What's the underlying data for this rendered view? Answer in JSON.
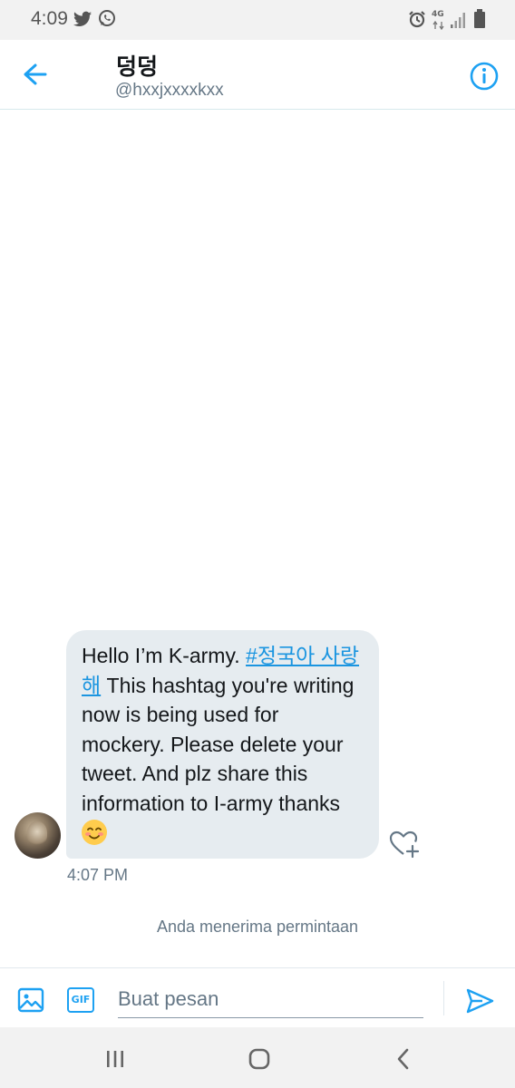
{
  "status_bar": {
    "time": "4:09",
    "network": "4G",
    "icons": [
      "twitter-icon",
      "whatsapp-icon",
      "alarm-icon",
      "signal-icon",
      "battery-icon"
    ]
  },
  "header": {
    "title": "덩덩",
    "handle": "@hxxjxxxxkxx",
    "accent_color": "#1da1f2"
  },
  "message": {
    "text_before": "Hello I’m K-army. ",
    "hashtag": "#정국아 사랑해",
    "text_after": " This hashtag you're writing now is being used for mockery. Please delete your tweet. And plz share this information to I-army thanks",
    "emoji": "smiling-face-emoji",
    "timestamp": "4:07 PM"
  },
  "notice": "Anda menerima permintaan",
  "composer": {
    "gif_label": "GIF",
    "placeholder": "Buat pesan"
  },
  "nav": {
    "icons": [
      "recent-apps-icon",
      "home-icon",
      "back-nav-icon"
    ]
  }
}
